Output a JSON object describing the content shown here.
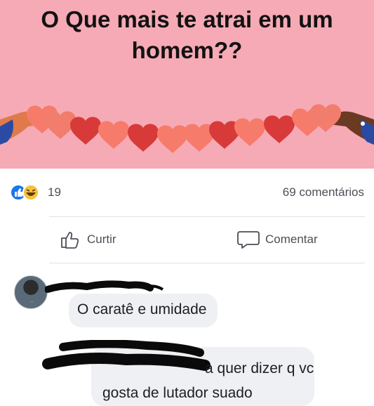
{
  "post": {
    "title": "O Que mais te atrai em um homem??"
  },
  "stats": {
    "reactions_count": "19",
    "comments_count": "69 comentários",
    "reaction_icons": [
      "like-icon",
      "haha-icon"
    ]
  },
  "actions": {
    "like_label": "Curtir",
    "comment_label": "Comentar"
  },
  "comments": [
    {
      "text": "O caratê e umidade"
    },
    {
      "text_line1": "a quer dizer q vc",
      "text_line2": "gosta de lutador suado"
    }
  ],
  "colors": {
    "banner_bg": "#f6aab6",
    "heart_light": "#f77b6b",
    "heart_dark": "#d83a3a",
    "like_blue": "#1877f2",
    "haha_yellow": "#f7c23a"
  }
}
